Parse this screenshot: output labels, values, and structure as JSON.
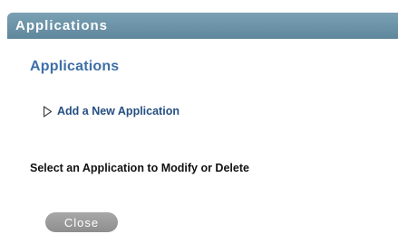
{
  "header": {
    "title": "Applications"
  },
  "main": {
    "section_title": "Applications",
    "add_link_label": "Add a New Application",
    "add_link_icon": "triangle-right-icon",
    "select_label": "Select an Application to Modify or Delete"
  },
  "actions": {
    "close_label": "Close"
  },
  "colors": {
    "header_bar": "#6b93a8",
    "section_title": "#3d6fa8",
    "link": "#254f82",
    "button": "#9a9a9a"
  }
}
